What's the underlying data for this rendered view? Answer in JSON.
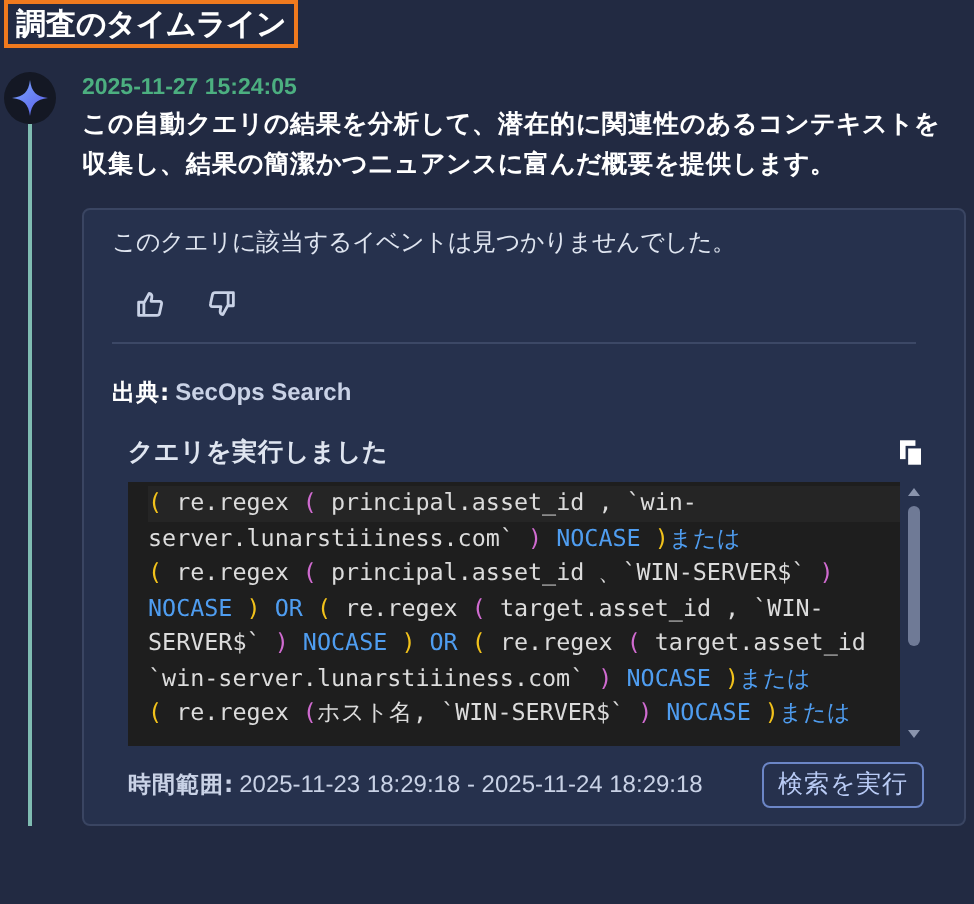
{
  "title": "調査のタイムライン",
  "entry": {
    "timestamp": "2025-11-27 15:24:05",
    "description": "この自動クエリの結果を分析して、潜在的に関連性のあるコンテキストを収集し、結果の簡潔かつニュアンスに富んだ概要を提供します。",
    "card": {
      "message": "このクエリに該当するイベントは見つかりませんでした。",
      "source": {
        "label": "出典:",
        "value": "SecOps Search"
      },
      "query_title": "クエリを実行しました",
      "code_lines": [
        {
          "tokens": [
            {
              "text": "( ",
              "kind": "paren-outer"
            },
            {
              "text": "re.regex ",
              "kind": "plain"
            },
            {
              "text": "( ",
              "kind": "paren-inner"
            },
            {
              "text": "principal.asset_id , `win-",
              "kind": "plain"
            }
          ]
        },
        {
          "tokens": [
            {
              "text": "server.lunarstiiiness.com` ",
              "kind": "plain"
            },
            {
              "text": ") ",
              "kind": "paren-inner"
            },
            {
              "text": "NOCASE ",
              "kind": "keyword"
            },
            {
              "text": ")",
              "kind": "paren-outer"
            },
            {
              "text": "または",
              "kind": "keyword"
            }
          ]
        },
        {
          "tokens": [
            {
              "text": "( ",
              "kind": "paren-outer"
            },
            {
              "text": "re.regex ",
              "kind": "plain"
            },
            {
              "text": "( ",
              "kind": "paren-inner"
            },
            {
              "text": "principal.asset_id 、`WIN-SERVER$` ",
              "kind": "plain"
            },
            {
              "text": ")",
              "kind": "paren-inner"
            }
          ]
        },
        {
          "tokens": [
            {
              "text": "NOCASE ",
              "kind": "keyword"
            },
            {
              "text": ") ",
              "kind": "paren-outer"
            },
            {
              "text": "OR ",
              "kind": "keyword"
            },
            {
              "text": "( ",
              "kind": "paren-outer"
            },
            {
              "text": "re.regex ",
              "kind": "plain"
            },
            {
              "text": "( ",
              "kind": "paren-inner"
            },
            {
              "text": "target.asset_id , `WIN-",
              "kind": "plain"
            }
          ]
        },
        {
          "tokens": [
            {
              "text": "SERVER$` ",
              "kind": "plain"
            },
            {
              "text": ") ",
              "kind": "paren-inner"
            },
            {
              "text": "NOCASE ",
              "kind": "keyword"
            },
            {
              "text": ") ",
              "kind": "paren-outer"
            },
            {
              "text": "OR ",
              "kind": "keyword"
            },
            {
              "text": "( ",
              "kind": "paren-outer"
            },
            {
              "text": "re.regex ",
              "kind": "plain"
            },
            {
              "text": "( ",
              "kind": "paren-inner"
            },
            {
              "text": "target.asset_id",
              "kind": "plain"
            }
          ]
        },
        {
          "tokens": [
            {
              "text": "`win-server.lunarstiiiness.com` ",
              "kind": "plain"
            },
            {
              "text": ") ",
              "kind": "paren-inner"
            },
            {
              "text": "NOCASE ",
              "kind": "keyword"
            },
            {
              "text": ")",
              "kind": "paren-outer"
            },
            {
              "text": "または",
              "kind": "keyword"
            }
          ]
        },
        {
          "tokens": [
            {
              "text": "( ",
              "kind": "paren-outer"
            },
            {
              "text": "re.regex ",
              "kind": "plain"
            },
            {
              "text": "(",
              "kind": "paren-inner"
            },
            {
              "text": "ホスト名, `WIN-SERVER$` ",
              "kind": "plain"
            },
            {
              "text": ") ",
              "kind": "paren-inner"
            },
            {
              "text": "NOCASE ",
              "kind": "keyword"
            },
            {
              "text": ")",
              "kind": "paren-outer"
            },
            {
              "text": "または",
              "kind": "keyword"
            }
          ]
        }
      ],
      "time_range": {
        "label": "時間範囲:",
        "value": "2025-11-23 18:29:18 - 2025-11-24 18:29:18"
      },
      "run_button": "検索を実行"
    }
  }
}
